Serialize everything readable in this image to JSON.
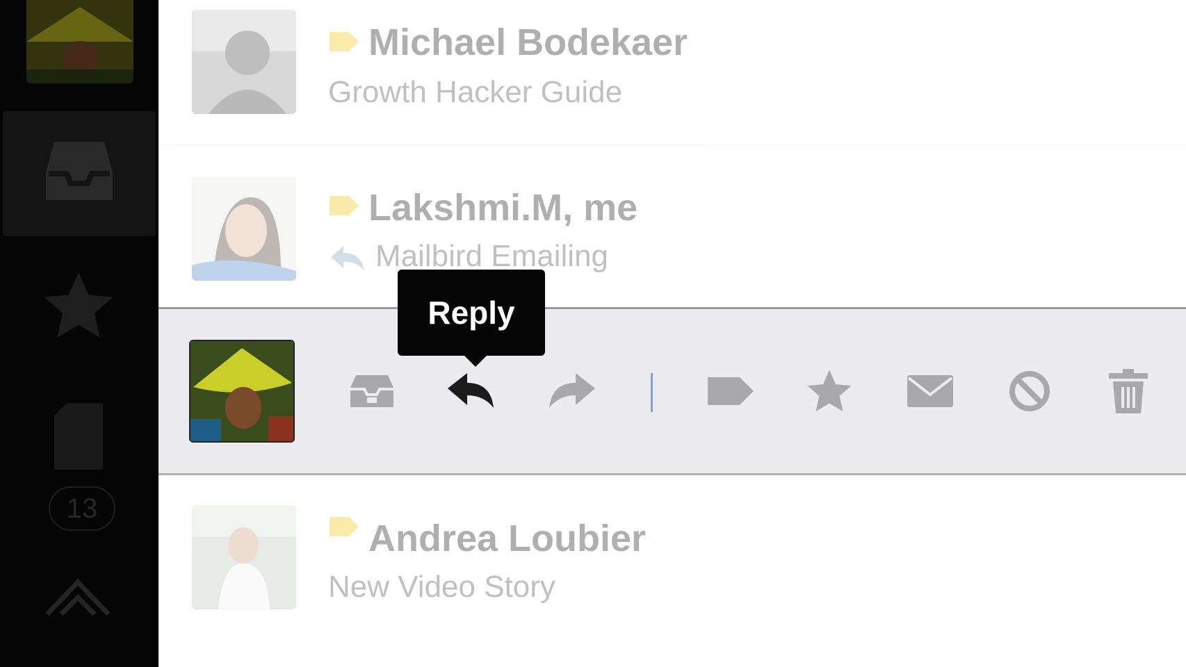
{
  "sidebar": {
    "unread_count": "13",
    "icons": [
      "account-avatar",
      "inbox-icon",
      "star-icon",
      "document-icon",
      "apps-icon"
    ]
  },
  "emails": [
    {
      "sender": "Michael Bodekaer",
      "subject": "Growth Hacker Guide",
      "replied": false,
      "tag_color": "#f5c400"
    },
    {
      "sender": "Lakshmi.M, me",
      "subject": "Mailbird Emailing",
      "replied": true,
      "tag_color": "#f5c400"
    },
    {
      "state": "hovered",
      "actions": [
        "archive-icon",
        "reply-icon",
        "forward-icon",
        "label-icon",
        "star-icon",
        "mark-unread-icon",
        "spam-icon",
        "delete-icon"
      ]
    },
    {
      "sender": "Andrea Loubier",
      "subject": "New Video Story",
      "replied": false,
      "tag_color": "#f5c400"
    }
  ],
  "tooltip": {
    "text": "Reply"
  },
  "colors": {
    "sidebar_bg": "#050505",
    "active_row_bg": "#ececee",
    "icon_gray": "#a9a9ab",
    "reply_icon": "#1b1b1b",
    "separator": "#8aa0cc"
  }
}
